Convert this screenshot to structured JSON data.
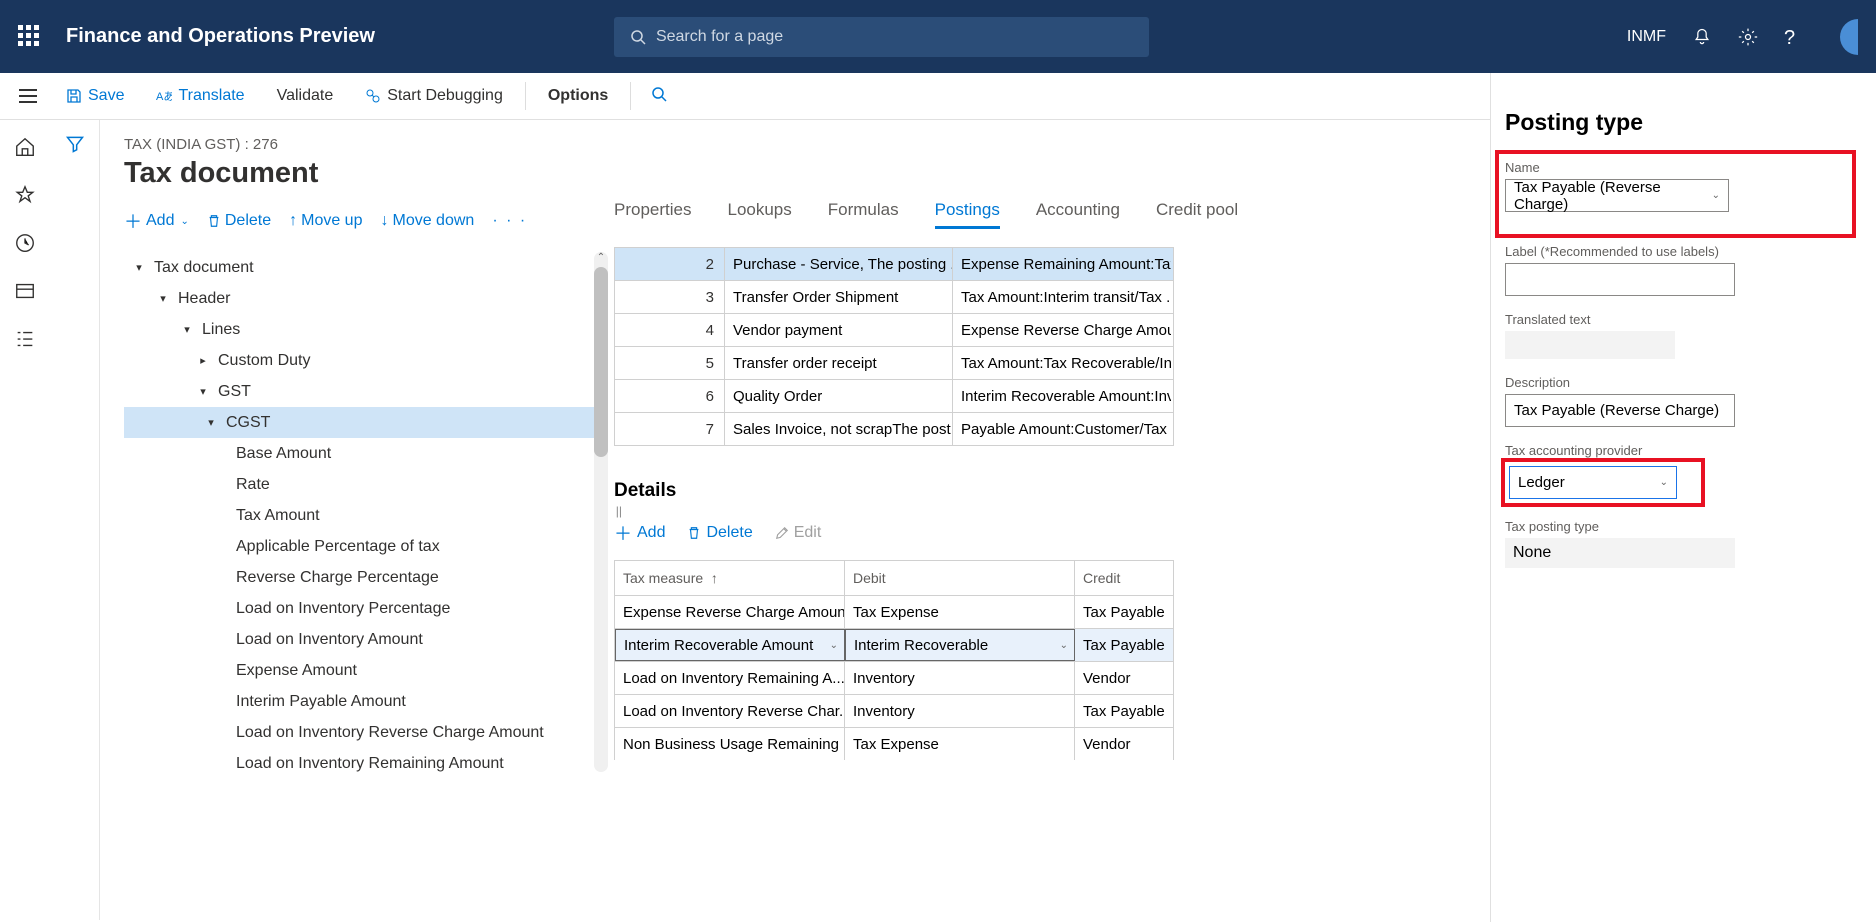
{
  "topbar": {
    "app_title": "Finance and Operations Preview",
    "search_placeholder": "Search for a page",
    "legal_entity": "INMF"
  },
  "actionbar": {
    "save": "Save",
    "translate": "Translate",
    "validate": "Validate",
    "start_debugging": "Start Debugging",
    "options": "Options"
  },
  "page": {
    "breadcrumb": "TAX (INDIA GST) : 276",
    "title": "Tax document"
  },
  "tree_actions": {
    "add": "Add",
    "delete": "Delete",
    "moveup": "Move up",
    "movedown": "Move down"
  },
  "tree": {
    "root": "Tax document",
    "header": "Header",
    "lines": "Lines",
    "custom_duty": "Custom Duty",
    "gst": "GST",
    "cgst": "CGST",
    "leaves": [
      "Base Amount",
      "Rate",
      "Tax Amount",
      "Applicable Percentage of tax",
      "Reverse Charge Percentage",
      "Load on Inventory Percentage",
      "Load on Inventory Amount",
      "Expense Amount",
      "Interim Payable Amount",
      "Load on Inventory Reverse Charge Amount",
      "Load on Inventory Remaining Amount"
    ]
  },
  "tabs": {
    "properties": "Properties",
    "lookups": "Lookups",
    "formulas": "Formulas",
    "postings": "Postings",
    "accounting": "Accounting",
    "credit_pool": "Credit pool"
  },
  "posting_rows": [
    {
      "n": "2",
      "a": "Purchase - Service, The posting ...",
      "b": "Expense Remaining Amount:Tax."
    },
    {
      "n": "3",
      "a": "Transfer Order Shipment",
      "b": "Tax Amount:Interim transit/Tax ..."
    },
    {
      "n": "4",
      "a": "Vendor payment",
      "b": "Expense Reverse Charge Amoun."
    },
    {
      "n": "5",
      "a": "Transfer order receipt",
      "b": "Tax Amount:Tax Recoverable/Int."
    },
    {
      "n": "6",
      "a": "Quality Order",
      "b": "Interim Recoverable Amount:Inv."
    },
    {
      "n": "7",
      "a": "Sales Invoice, not scrapThe post...",
      "b": "Payable Amount:Customer/Tax ..."
    }
  ],
  "details": {
    "heading": "Details",
    "add": "Add",
    "delete": "Delete",
    "edit": "Edit",
    "col_tax": "Tax measure",
    "col_debit": "Debit",
    "col_credit": "Credit",
    "rows": [
      {
        "tax": "Expense Reverse Charge Amount",
        "debit": "Tax Expense",
        "credit": "Tax Payable"
      },
      {
        "tax": "Interim Recoverable Amount",
        "debit": "Interim Recoverable",
        "credit": "Tax Payable"
      },
      {
        "tax": "Load on Inventory Remaining A...",
        "debit": "Inventory",
        "credit": "Vendor"
      },
      {
        "tax": "Load on Inventory Reverse Char...",
        "debit": "Inventory",
        "credit": "Tax Payable"
      },
      {
        "tax": "Non Business Usage Remaining ...",
        "debit": "Tax Expense",
        "credit": "Vendor"
      }
    ]
  },
  "sidepanel": {
    "title": "Posting type",
    "name_label": "Name",
    "name_value": "Tax Payable (Reverse Charge)",
    "label_label": "Label (*Recommended to use labels)",
    "label_value": "",
    "translated_label": "Translated text",
    "translated_value": "",
    "description_label": "Description",
    "description_value": "Tax Payable (Reverse Charge)",
    "provider_label": "Tax accounting provider",
    "provider_value": "Ledger",
    "posting_type_label": "Tax posting type",
    "posting_type_value": "None"
  }
}
